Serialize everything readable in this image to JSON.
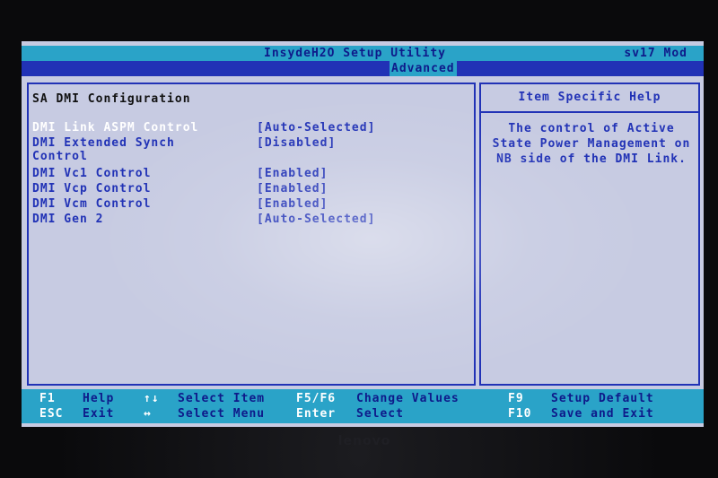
{
  "header": {
    "title": "InsydeH2O Setup Utility",
    "model": "sv17 Mod"
  },
  "menu": {
    "active_tab": "Advanced"
  },
  "section": {
    "title": "SA DMI Configuration"
  },
  "settings": [
    {
      "label": "DMI Link ASPM Control",
      "value": "[Auto-Selected]",
      "selected": true
    },
    {
      "label": "DMI Extended Synch",
      "label2": "Control",
      "value": "[Disabled]"
    },
    {
      "label": "DMI Vc1 Control",
      "value": "[Enabled]"
    },
    {
      "label": "DMI Vcp Control",
      "value": "[Enabled]"
    },
    {
      "label": "DMI Vcm Control",
      "value": "[Enabled]"
    },
    {
      "label": "DMI Gen 2",
      "value": "[Auto-Selected]"
    }
  ],
  "help": {
    "title": "Item Specific Help",
    "line1": "The control of Active",
    "line2": "State Power Management on",
    "line3": "NB side of the DMI Link."
  },
  "footer": {
    "row1": [
      {
        "key": "F1",
        "desc": "Help"
      },
      {
        "key": "↑↓",
        "desc": "Select Item"
      },
      {
        "key": "F5/F6",
        "desc": "Change Values"
      },
      {
        "key": "F9",
        "desc": "Setup Default"
      }
    ],
    "row2": [
      {
        "key": "ESC",
        "desc": "Exit"
      },
      {
        "key": "↔",
        "desc": "Select Menu"
      },
      {
        "key": "Enter",
        "desc": "Select"
      },
      {
        "key": "F10",
        "desc": "Save and Exit"
      }
    ]
  },
  "bezel": {
    "logo": "lenovo"
  },
  "colors": {
    "background": "#c7cbe2",
    "accent_blue": "#2132b6",
    "cyan_bar": "#2aa3c8",
    "selected_text": "#ffffff"
  }
}
